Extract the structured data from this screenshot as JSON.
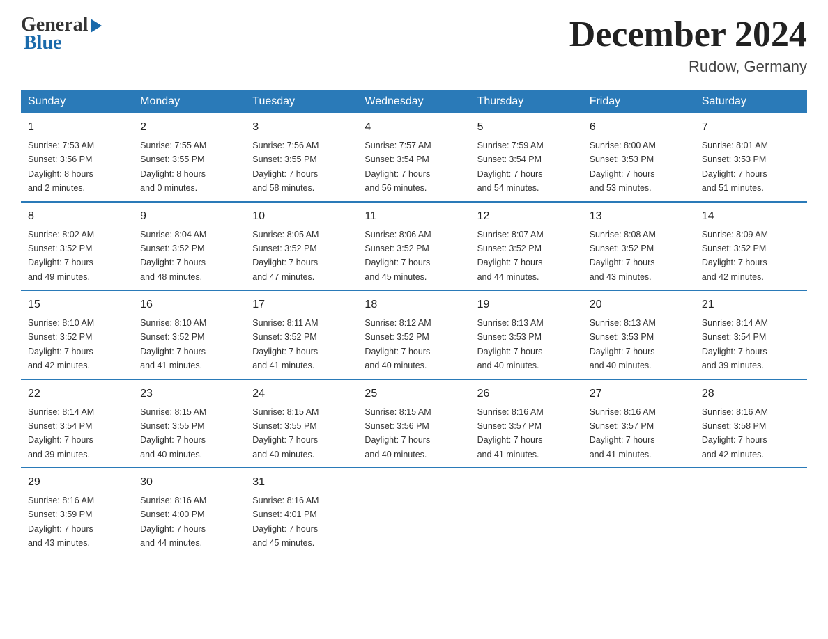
{
  "logo": {
    "general": "General",
    "blue": "Blue",
    "subtitle": "Blue"
  },
  "header": {
    "month_year": "December 2024",
    "location": "Rudow, Germany"
  },
  "days_of_week": [
    "Sunday",
    "Monday",
    "Tuesday",
    "Wednesday",
    "Thursday",
    "Friday",
    "Saturday"
  ],
  "weeks": [
    [
      {
        "day": "1",
        "sunrise": "7:53 AM",
        "sunset": "3:56 PM",
        "daylight": "8 hours and 2 minutes."
      },
      {
        "day": "2",
        "sunrise": "7:55 AM",
        "sunset": "3:55 PM",
        "daylight": "8 hours and 0 minutes."
      },
      {
        "day": "3",
        "sunrise": "7:56 AM",
        "sunset": "3:55 PM",
        "daylight": "7 hours and 58 minutes."
      },
      {
        "day": "4",
        "sunrise": "7:57 AM",
        "sunset": "3:54 PM",
        "daylight": "7 hours and 56 minutes."
      },
      {
        "day": "5",
        "sunrise": "7:59 AM",
        "sunset": "3:54 PM",
        "daylight": "7 hours and 54 minutes."
      },
      {
        "day": "6",
        "sunrise": "8:00 AM",
        "sunset": "3:53 PM",
        "daylight": "7 hours and 53 minutes."
      },
      {
        "day": "7",
        "sunrise": "8:01 AM",
        "sunset": "3:53 PM",
        "daylight": "7 hours and 51 minutes."
      }
    ],
    [
      {
        "day": "8",
        "sunrise": "8:02 AM",
        "sunset": "3:52 PM",
        "daylight": "7 hours and 49 minutes."
      },
      {
        "day": "9",
        "sunrise": "8:04 AM",
        "sunset": "3:52 PM",
        "daylight": "7 hours and 48 minutes."
      },
      {
        "day": "10",
        "sunrise": "8:05 AM",
        "sunset": "3:52 PM",
        "daylight": "7 hours and 47 minutes."
      },
      {
        "day": "11",
        "sunrise": "8:06 AM",
        "sunset": "3:52 PM",
        "daylight": "7 hours and 45 minutes."
      },
      {
        "day": "12",
        "sunrise": "8:07 AM",
        "sunset": "3:52 PM",
        "daylight": "7 hours and 44 minutes."
      },
      {
        "day": "13",
        "sunrise": "8:08 AM",
        "sunset": "3:52 PM",
        "daylight": "7 hours and 43 minutes."
      },
      {
        "day": "14",
        "sunrise": "8:09 AM",
        "sunset": "3:52 PM",
        "daylight": "7 hours and 42 minutes."
      }
    ],
    [
      {
        "day": "15",
        "sunrise": "8:10 AM",
        "sunset": "3:52 PM",
        "daylight": "7 hours and 42 minutes."
      },
      {
        "day": "16",
        "sunrise": "8:10 AM",
        "sunset": "3:52 PM",
        "daylight": "7 hours and 41 minutes."
      },
      {
        "day": "17",
        "sunrise": "8:11 AM",
        "sunset": "3:52 PM",
        "daylight": "7 hours and 41 minutes."
      },
      {
        "day": "18",
        "sunrise": "8:12 AM",
        "sunset": "3:52 PM",
        "daylight": "7 hours and 40 minutes."
      },
      {
        "day": "19",
        "sunrise": "8:13 AM",
        "sunset": "3:53 PM",
        "daylight": "7 hours and 40 minutes."
      },
      {
        "day": "20",
        "sunrise": "8:13 AM",
        "sunset": "3:53 PM",
        "daylight": "7 hours and 40 minutes."
      },
      {
        "day": "21",
        "sunrise": "8:14 AM",
        "sunset": "3:54 PM",
        "daylight": "7 hours and 39 minutes."
      }
    ],
    [
      {
        "day": "22",
        "sunrise": "8:14 AM",
        "sunset": "3:54 PM",
        "daylight": "7 hours and 39 minutes."
      },
      {
        "day": "23",
        "sunrise": "8:15 AM",
        "sunset": "3:55 PM",
        "daylight": "7 hours and 40 minutes."
      },
      {
        "day": "24",
        "sunrise": "8:15 AM",
        "sunset": "3:55 PM",
        "daylight": "7 hours and 40 minutes."
      },
      {
        "day": "25",
        "sunrise": "8:15 AM",
        "sunset": "3:56 PM",
        "daylight": "7 hours and 40 minutes."
      },
      {
        "day": "26",
        "sunrise": "8:16 AM",
        "sunset": "3:57 PM",
        "daylight": "7 hours and 41 minutes."
      },
      {
        "day": "27",
        "sunrise": "8:16 AM",
        "sunset": "3:57 PM",
        "daylight": "7 hours and 41 minutes."
      },
      {
        "day": "28",
        "sunrise": "8:16 AM",
        "sunset": "3:58 PM",
        "daylight": "7 hours and 42 minutes."
      }
    ],
    [
      {
        "day": "29",
        "sunrise": "8:16 AM",
        "sunset": "3:59 PM",
        "daylight": "7 hours and 43 minutes."
      },
      {
        "day": "30",
        "sunrise": "8:16 AM",
        "sunset": "4:00 PM",
        "daylight": "7 hours and 44 minutes."
      },
      {
        "day": "31",
        "sunrise": "8:16 AM",
        "sunset": "4:01 PM",
        "daylight": "7 hours and 45 minutes."
      },
      null,
      null,
      null,
      null
    ]
  ],
  "labels": {
    "sunrise": "Sunrise:",
    "sunset": "Sunset:",
    "daylight": "Daylight:"
  }
}
